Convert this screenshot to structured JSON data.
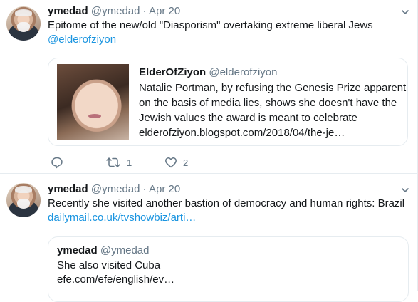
{
  "tweets": [
    {
      "name": "ymedad",
      "handle": "@ymedad",
      "separator": "·",
      "date": "Apr 20",
      "text": "Epitome of the new/old \"Diasporism\" overtaking extreme liberal Jews",
      "link": "@elderofziyon",
      "card": {
        "name": "ElderOfZiyon",
        "handle": "@elderofziyon",
        "lines": [
          "Natalie Portman, by refusing the Genesis Prize apparently",
          "on the basis of media lies, shows she doesn't have the",
          "Jewish values the award is meant to celebrate",
          "elderofziyon.blogspot.com/2018/04/the-je…"
        ]
      },
      "actions": {
        "reply": "",
        "retweet": "1",
        "like": "2"
      }
    },
    {
      "name": "ymedad",
      "handle": "@ymedad",
      "separator": "·",
      "date": "Apr 20",
      "text": "Recently she visited another bastion of democracy and human rights: Brazil",
      "link": "dailymail.co.uk/tvshowbiz/arti…",
      "quote": {
        "name": "ymedad",
        "handle": "@ymedad",
        "lines": [
          "She also visited Cuba",
          "efe.com/efe/english/ev…"
        ]
      }
    }
  ],
  "icons": {
    "menu": "chevron-down-icon",
    "reply": "reply-icon",
    "retweet": "retweet-icon",
    "like": "heart-icon"
  },
  "colors": {
    "link": "#1b95e0",
    "muted": "#657786",
    "border": "#e6ecf0",
    "text": "#14171a"
  }
}
